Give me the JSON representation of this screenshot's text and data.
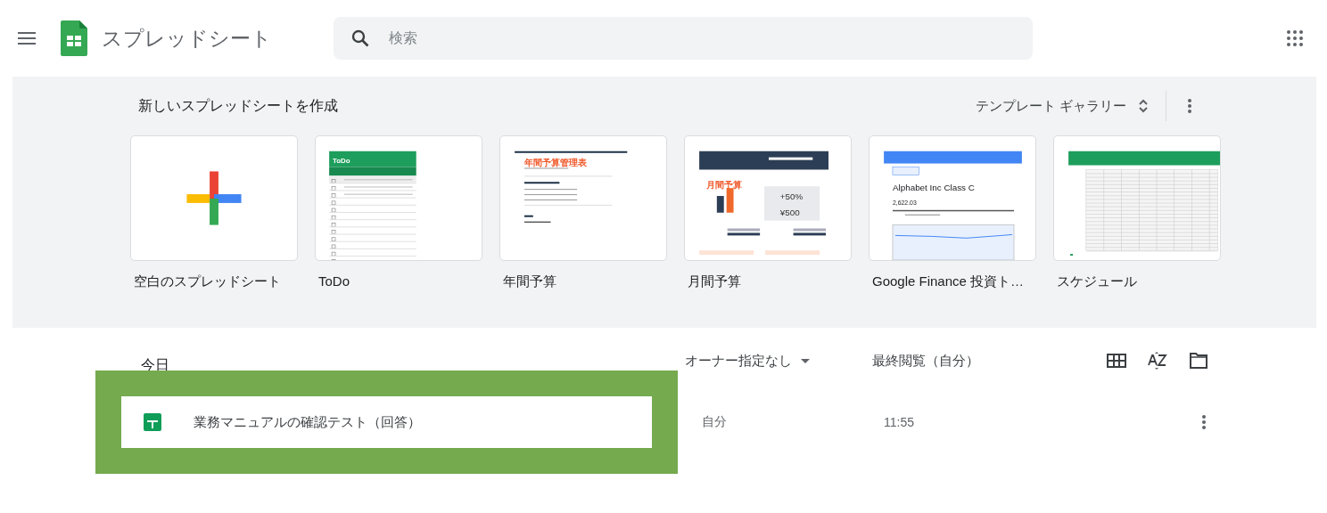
{
  "app_bar": {
    "title": "スプレッドシート",
    "search": {
      "placeholder": "検索"
    }
  },
  "template_gallery": {
    "heading": "新しいスプレッドシートを作成",
    "gallery_button": "テンプレート ギャラリー",
    "templates": [
      {
        "kind": "blank",
        "label": "空白のスプレッドシート"
      },
      {
        "kind": "todo",
        "label": "ToDo",
        "preview_texts": [
          "ToDo"
        ]
      },
      {
        "kind": "annual",
        "label": "年間予算",
        "preview_texts": [
          "年間予算管理表"
        ]
      },
      {
        "kind": "monthly",
        "label": "月間予算",
        "preview_texts": [
          "月間予算",
          "+50%",
          "¥500"
        ]
      },
      {
        "kind": "finance",
        "label": "Google Finance 投資ト…",
        "preview_texts": [
          "Alphabet Inc Class C",
          "2,622.03"
        ]
      },
      {
        "kind": "schedule",
        "label": "スケジュール"
      }
    ]
  },
  "file_list": {
    "section": "今日",
    "owner_filter": "オーナー指定なし",
    "sort_column": "最終閲覧（自分）",
    "rows": [
      {
        "title": "業務マニュアルの確認テスト（回答）",
        "owner": "自分",
        "last_opened": "11:55",
        "highlighted": true
      }
    ]
  }
}
